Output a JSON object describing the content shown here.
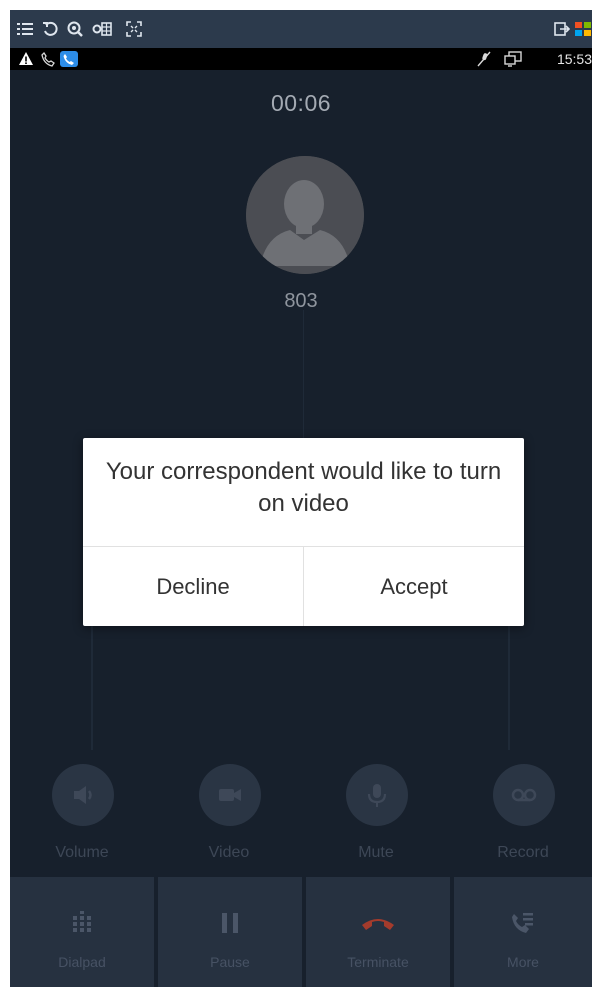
{
  "status_bar": {
    "time": "15:53"
  },
  "call": {
    "timer": "00:06",
    "caller": "803"
  },
  "dialog": {
    "message": "Your correspondent would like to turn on video",
    "decline_label": "Decline",
    "accept_label": "Accept"
  },
  "actions": [
    {
      "label": "Volume",
      "icon": "volume-icon"
    },
    {
      "label": "Video",
      "icon": "video-camera-icon"
    },
    {
      "label": "Mute",
      "icon": "microphone-icon"
    },
    {
      "label": "Record",
      "icon": "record-tape-icon"
    }
  ],
  "bottom_bar": [
    {
      "label": "Dialpad",
      "icon": "dialpad-icon"
    },
    {
      "label": "Pause",
      "icon": "pause-icon"
    },
    {
      "label": "Terminate",
      "icon": "hangup-icon",
      "color": "#a43b2c"
    },
    {
      "label": "More",
      "icon": "more-icon"
    }
  ],
  "colors": {
    "background": "#17202c",
    "bottom_bar": "#263140",
    "dialog": "#ffffff",
    "terminate": "#a43b2c"
  }
}
